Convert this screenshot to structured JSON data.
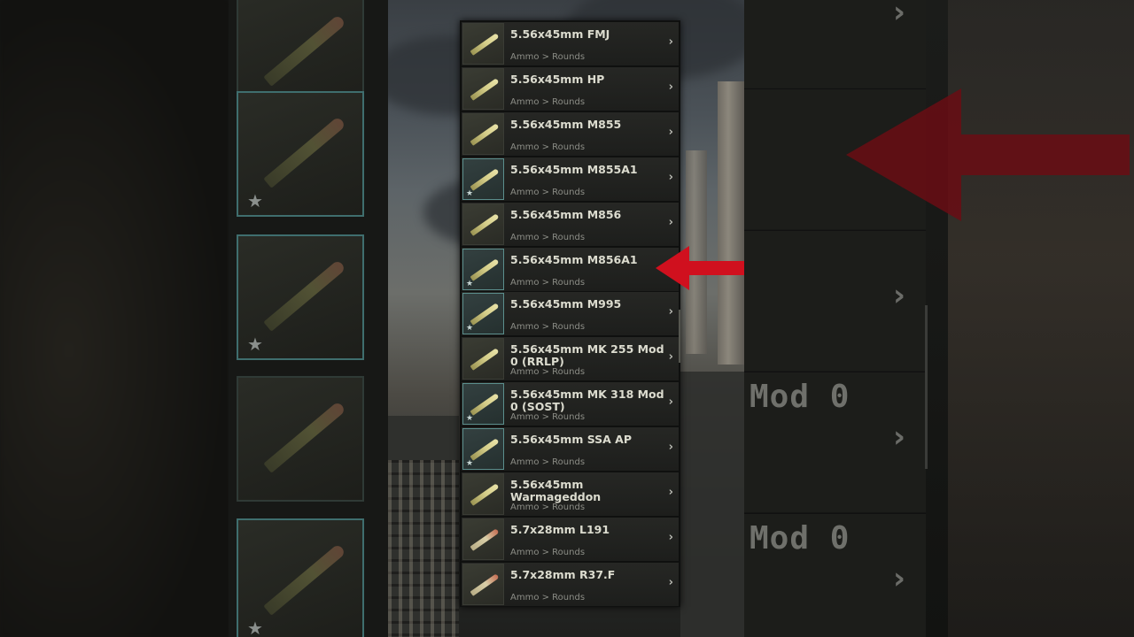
{
  "list": {
    "items": [
      {
        "title": "5.56x45mm FMJ",
        "category": "Ammo > Rounds",
        "favorite": false,
        "tint": "brass"
      },
      {
        "title": "5.56x45mm HP",
        "category": "Ammo > Rounds",
        "favorite": false,
        "tint": "brass"
      },
      {
        "title": "5.56x45mm M855",
        "category": "Ammo > Rounds",
        "favorite": false,
        "tint": "brass"
      },
      {
        "title": "5.56x45mm M855A1",
        "category": "Ammo > Rounds",
        "favorite": true,
        "tint": "brass"
      },
      {
        "title": "5.56x45mm M856",
        "category": "Ammo > Rounds",
        "favorite": false,
        "tint": "brass"
      },
      {
        "title": "5.56x45mm M856A1",
        "category": "Ammo > Rounds",
        "favorite": true,
        "tint": "brass"
      },
      {
        "title": "5.56x45mm M995",
        "category": "Ammo > Rounds",
        "favorite": true,
        "tint": "brass"
      },
      {
        "title": "5.56x45mm MK 255 Mod 0 (RRLP)",
        "category": "Ammo > Rounds",
        "favorite": false,
        "tint": "brass"
      },
      {
        "title": "5.56x45mm MK 318 Mod 0 (SOST)",
        "category": "Ammo > Rounds",
        "favorite": true,
        "tint": "brass"
      },
      {
        "title": "5.56x45mm SSA AP",
        "category": "Ammo > Rounds",
        "favorite": true,
        "tint": "brass"
      },
      {
        "title": "5.56x45mm Warmageddon",
        "category": "Ammo > Rounds",
        "favorite": false,
        "tint": "brass"
      },
      {
        "title": "5.7x28mm L191",
        "category": "Ammo > Rounds",
        "favorite": false,
        "tint": "copper"
      },
      {
        "title": "5.7x28mm R37.F",
        "category": "Ammo > Rounds",
        "favorite": false,
        "tint": "copper"
      }
    ]
  },
  "background_right": {
    "ghost_texts": [
      "Mod 0",
      "Mod 0"
    ]
  },
  "icons": {
    "chevron": "›",
    "star": "★"
  },
  "colors": {
    "highlight_arrow": "#d0101e",
    "favorite_border": "#5b8e8c",
    "title_text": "#dcdccf"
  }
}
